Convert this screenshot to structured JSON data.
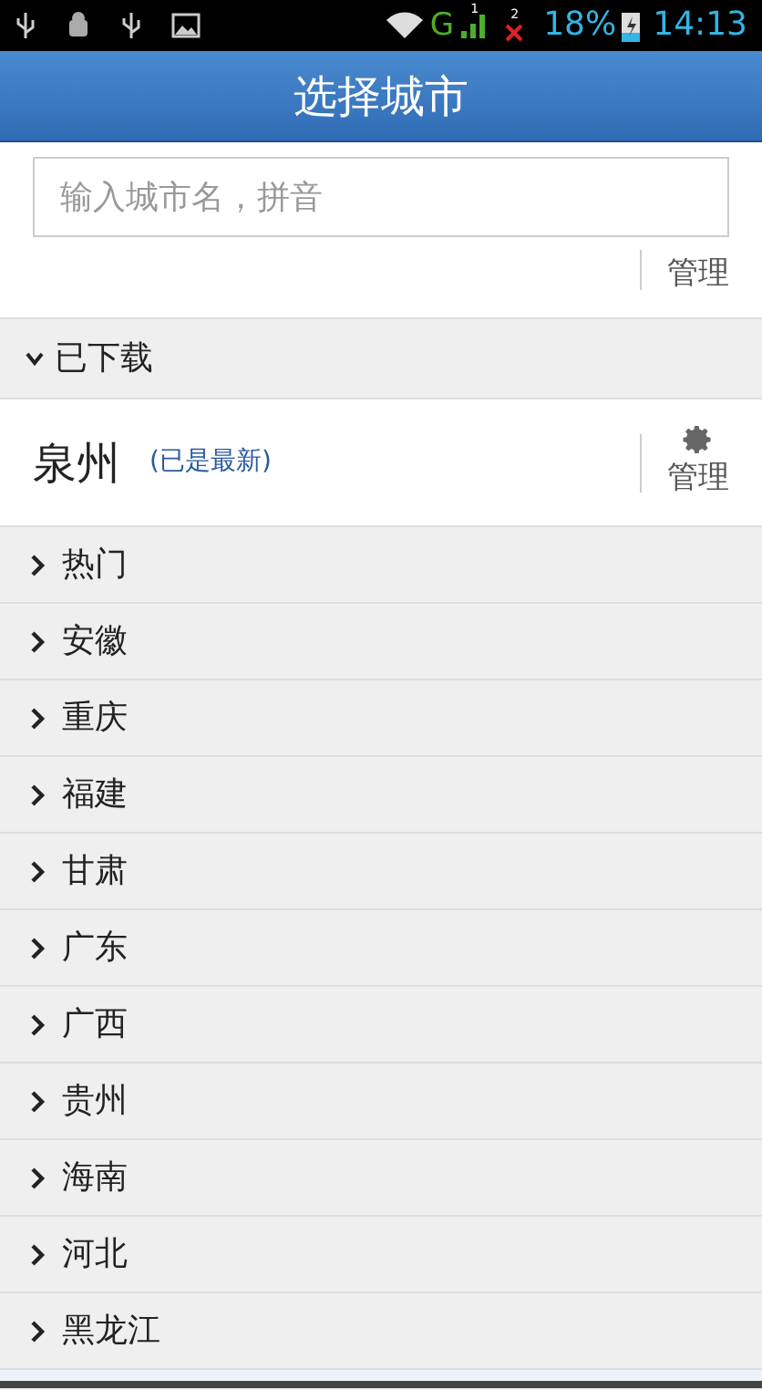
{
  "status_bar": {
    "network": "G",
    "sim_1": "1",
    "sim_2": "2",
    "battery": "18%",
    "time": "14:13"
  },
  "title": "选择城市",
  "search": {
    "placeholder": "输入城市名，拼音"
  },
  "scrolled_row": {
    "action": "管理"
  },
  "downloaded": {
    "label": "已下载",
    "expanded": true,
    "rows": [
      {
        "city": "泉州",
        "status": "(已是最新)",
        "action": "管理"
      }
    ]
  },
  "provinces": [
    {
      "name": "热门",
      "expanded": false
    },
    {
      "name": "安徽",
      "expanded": false
    },
    {
      "name": "重庆",
      "expanded": false
    },
    {
      "name": "福建",
      "expanded": false
    },
    {
      "name": "甘肃",
      "expanded": false
    },
    {
      "name": "广东",
      "expanded": false
    },
    {
      "name": "广西",
      "expanded": false
    },
    {
      "name": "贵州",
      "expanded": false
    },
    {
      "name": "海南",
      "expanded": false
    },
    {
      "name": "河北",
      "expanded": false
    },
    {
      "name": "黑龙江",
      "expanded": false
    }
  ]
}
